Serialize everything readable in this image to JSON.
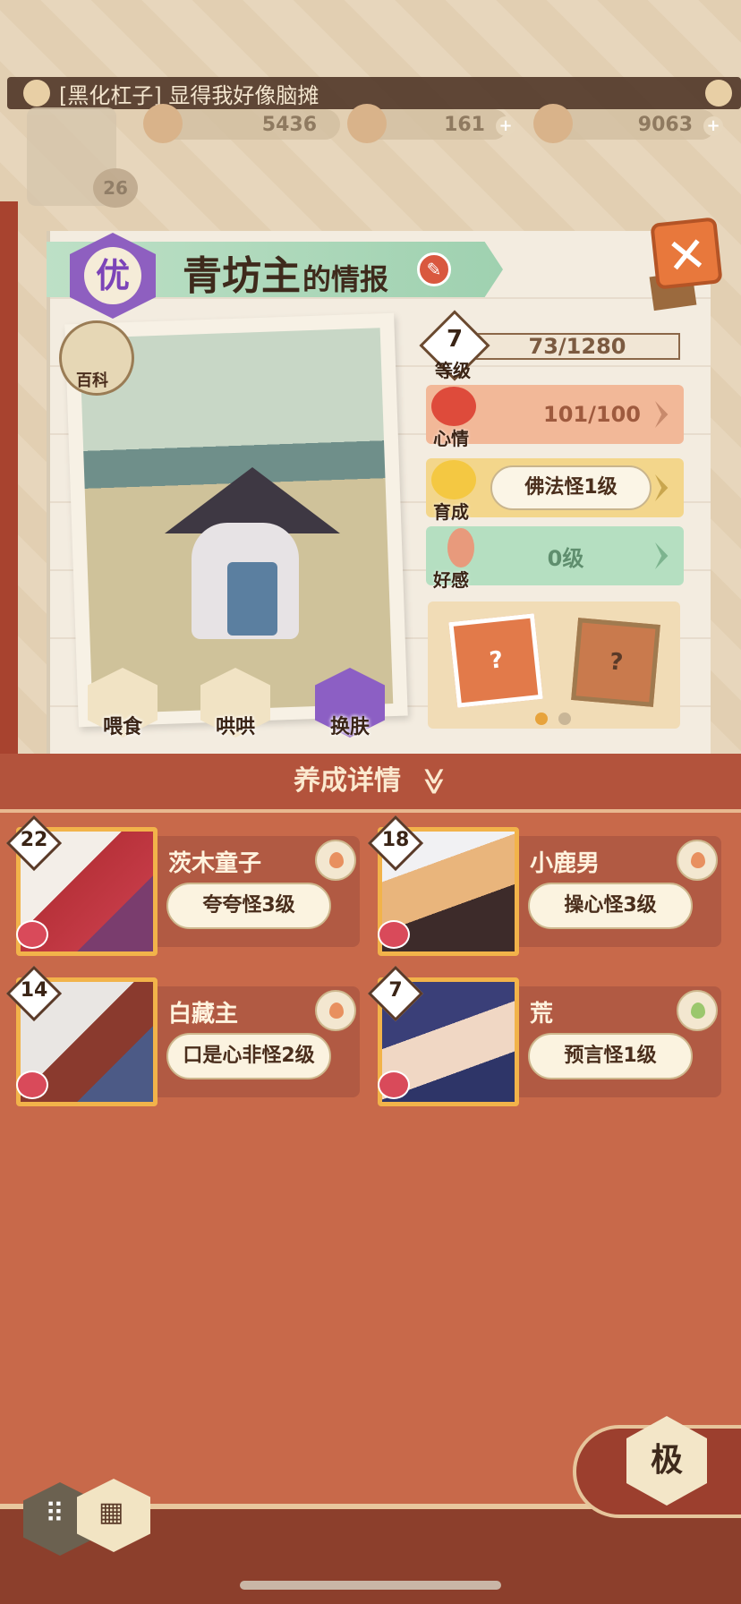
{
  "header": {
    "banner_text": "[黑化杠子] 显得我好像脑摊",
    "avatar_level": "26",
    "resources": [
      {
        "name": "plum",
        "value": "5436"
      },
      {
        "name": "magatama",
        "value": "161"
      },
      {
        "name": "coin",
        "value": "9063"
      }
    ]
  },
  "info": {
    "rank": "优",
    "name": "青坊主",
    "name_suffix": "的情报",
    "encyclopedia_label": "百科",
    "level": "7",
    "level_label": "等级",
    "exp": "73/1280",
    "mood_label": "心情",
    "mood_value": "101/100",
    "growth_label": "育成",
    "growth_value": "佛法怪1级",
    "affinity_label": "好感",
    "affinity_value": "0级",
    "card_marks": [
      "?",
      "?"
    ]
  },
  "actions": [
    {
      "label": "喂食"
    },
    {
      "label": "哄哄"
    },
    {
      "label": "换肤"
    }
  ],
  "section": {
    "title": "养成详情",
    "chevron": "≫"
  },
  "companions": [
    {
      "level": "22",
      "name": "茨木童子",
      "tag": "夸夸怪3级",
      "peach_color": "#e8905f"
    },
    {
      "level": "18",
      "name": "小鹿男",
      "tag": "操心怪3级",
      "peach_color": "#e8905f"
    },
    {
      "level": "14",
      "name": "白藏主",
      "tag": "口是心非怪2级",
      "peach_color": "#e8905f"
    },
    {
      "level": "7",
      "name": "荒",
      "tag": "预言怪1级",
      "peach_color": "#9bc76d"
    }
  ],
  "bottom": {
    "ji_label": "极"
  }
}
